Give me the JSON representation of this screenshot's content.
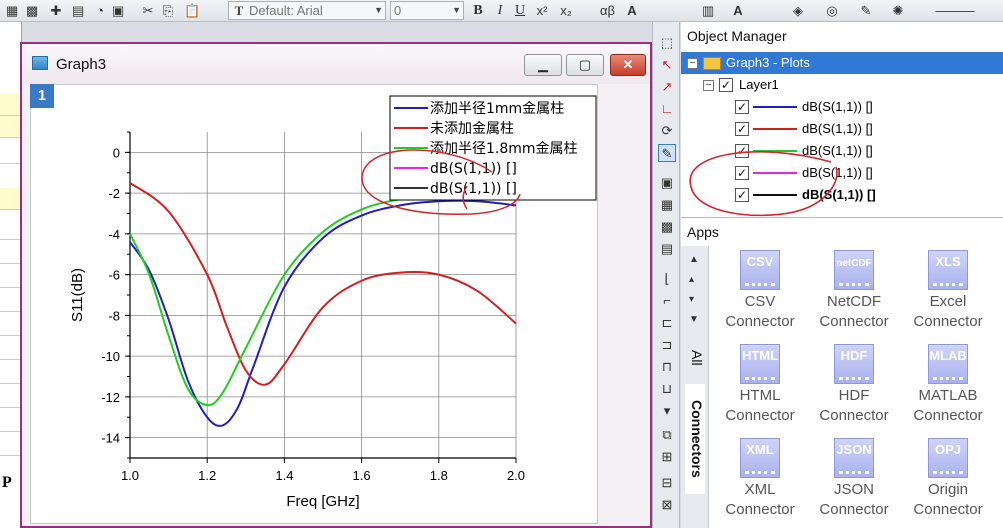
{
  "toolbar": {
    "font_name": "Default: Arial",
    "font_size": "0",
    "bold": "B",
    "italic": "I",
    "underline": "U",
    "superscript": "x²",
    "subscript": "x₂",
    "greek": "αβ",
    "text_tool": "A"
  },
  "graph_window": {
    "title": "Graph3",
    "layer_number": "1"
  },
  "chart_data": {
    "type": "line",
    "xlabel": "Freq [GHz]",
    "ylabel": "S11(dB)",
    "xlim": [
      1.0,
      2.0
    ],
    "ylim": [
      -15,
      1
    ],
    "x_ticks": [
      "1.0",
      "1.2",
      "1.4",
      "1.6",
      "1.8",
      "2.0"
    ],
    "y_ticks": [
      "0",
      "-2",
      "-4",
      "-6",
      "-8",
      "-10",
      "-12",
      "-14"
    ],
    "grid": true,
    "legend_position": "top-right",
    "series": [
      {
        "name": "添加半径1mm金属柱",
        "color": "#1f1fbf",
        "x": [
          1.0,
          1.05,
          1.1,
          1.15,
          1.2,
          1.24,
          1.28,
          1.32,
          1.4,
          1.5,
          1.6,
          1.7,
          1.8,
          1.9,
          2.0
        ],
        "y": [
          -4.4,
          -5.8,
          -8.2,
          -11.2,
          -13.0,
          -13.4,
          -12.5,
          -10.5,
          -6.6,
          -4.2,
          -3.1,
          -2.6,
          -2.4,
          -2.4,
          -2.6
        ]
      },
      {
        "name": "未添加金属柱",
        "color": "#d02020",
        "x": [
          1.0,
          1.1,
          1.2,
          1.25,
          1.3,
          1.35,
          1.4,
          1.5,
          1.6,
          1.7,
          1.8,
          1.9,
          2.0
        ],
        "y": [
          -1.5,
          -2.9,
          -6.0,
          -8.5,
          -10.7,
          -11.4,
          -10.4,
          -7.6,
          -6.3,
          -5.9,
          -6.0,
          -6.8,
          -8.4
        ]
      },
      {
        "name": "添加半径1.8mm金属柱",
        "color": "#22cc22",
        "x": [
          1.0,
          1.05,
          1.1,
          1.15,
          1.2,
          1.24,
          1.3,
          1.4,
          1.5,
          1.6,
          1.7,
          1.8,
          1.9,
          2.0
        ],
        "y": [
          -4.0,
          -6.0,
          -9.0,
          -11.6,
          -12.4,
          -11.8,
          -9.6,
          -6.0,
          -3.9,
          -2.8,
          -2.3,
          -2.1,
          -2.1,
          -2.2
        ]
      },
      {
        "name": "dB(S(1,1)) []",
        "color": "#ee22ee",
        "x": [],
        "y": []
      },
      {
        "name": "dB(S(1,1)) []",
        "color": "#333333",
        "x": [],
        "y": []
      }
    ]
  },
  "object_manager": {
    "title": "Object Manager",
    "root": "Graph3 - Plots",
    "layer": "Layer1",
    "plots": [
      {
        "label": "dB(S(1,1)) []",
        "color": "#1f1fbf",
        "bold": false
      },
      {
        "label": "dB(S(1,1)) []",
        "color": "#d02020",
        "bold": false
      },
      {
        "label": "dB(S(1,1)) []",
        "color": "#22cc22",
        "bold": false
      },
      {
        "label": "dB(S(1,1)) []",
        "color": "#ee22ee",
        "bold": false
      },
      {
        "label": "dB(S(1,1)) []",
        "color": "#111111",
        "bold": true
      }
    ]
  },
  "apps": {
    "title": "Apps",
    "tab_all": "All",
    "tab_connectors": "Connectors",
    "items": [
      {
        "icon": "CSV",
        "name1": "CSV",
        "name2": "Connector"
      },
      {
        "icon": "netCDF",
        "name1": "NetCDF",
        "name2": "Connector"
      },
      {
        "icon": "XLS",
        "name1": "Excel",
        "name2": "Connector"
      },
      {
        "icon": "HTML",
        "name1": "HTML",
        "name2": "Connector"
      },
      {
        "icon": "HDF",
        "name1": "HDF",
        "name2": "Connector"
      },
      {
        "icon": "MLAB",
        "name1": "MATLAB",
        "name2": "Connector"
      },
      {
        "icon": "XML",
        "name1": "XML",
        "name2": "Connector"
      },
      {
        "icon": "JSON",
        "name1": "JSON",
        "name2": "Connector"
      },
      {
        "icon": "OPJ",
        "name1": "Origin",
        "name2": "Connector"
      }
    ]
  },
  "worksheet": {
    "partial_label": "P"
  }
}
